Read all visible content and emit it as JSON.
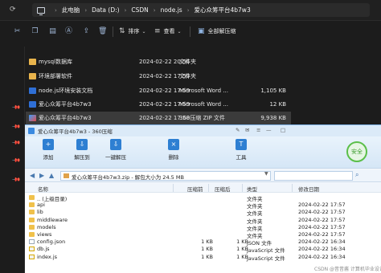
{
  "explorer": {
    "breadcrumb": [
      "此电脑",
      "Data (D:)",
      "CSDN",
      "node.js",
      "爱心众筹平台4b7w3"
    ],
    "toolbar": {
      "sort_label": "排序",
      "view_label": "查看",
      "extract_all_label": "全部解压缩"
    },
    "files": [
      {
        "name": "mysql数据库",
        "date": "2024-02-22 20:56",
        "type": "文件夹",
        "size": "",
        "icon": "folder-icon"
      },
      {
        "name": "环境部署软件",
        "date": "2024-02-22 17:59",
        "type": "文件夹",
        "size": "",
        "icon": "folder-icon"
      },
      {
        "name": "node.js环境安装文档",
        "date": "2024-02-22 17:59",
        "type": "Microsoft Word ...",
        "size": "1,105 KB",
        "icon": "word-doc-icon"
      },
      {
        "name": "爱心众筹平台4b7w3",
        "date": "2024-02-22 17:59",
        "type": "Microsoft Word ...",
        "size": "12 KB",
        "icon": "word-doc-icon"
      },
      {
        "name": "爱心众筹平台4b7w3",
        "date": "2024-02-22 17:58",
        "type": "360压缩 ZIP 文件",
        "size": "9,938 KB",
        "icon": "zip-icon"
      }
    ]
  },
  "zip": {
    "title": "爱心众筹平台4b7w3 - 360压缩",
    "tools": [
      {
        "label": "添加",
        "glyph": "+"
      },
      {
        "label": "解压到",
        "glyph": "⇩"
      },
      {
        "label": "一键解压",
        "glyph": "⇩"
      },
      {
        "label": "删除",
        "glyph": "×"
      },
      {
        "label": "工具",
        "glyph": "T"
      }
    ],
    "safe_label": "安全",
    "path_text": "爱心众筹平台4b7w3.zip - 解包大小为 24.5 MB",
    "columns": {
      "name": "名称",
      "size": "压缩前",
      "compressed": "压缩后",
      "type": "类型",
      "date": "修改日期"
    },
    "rows": [
      {
        "name": ".. (上级目录)",
        "size": "",
        "compressed": "",
        "type": "文件夹",
        "date": "",
        "kind": "folder"
      },
      {
        "name": "api",
        "size": "",
        "compressed": "",
        "type": "文件夹",
        "date": "2024-02-22 17:57",
        "kind": "folder"
      },
      {
        "name": "lib",
        "size": "",
        "compressed": "",
        "type": "文件夹",
        "date": "2024-02-22 17:57",
        "kind": "folder"
      },
      {
        "name": "middleware",
        "size": "",
        "compressed": "",
        "type": "文件夹",
        "date": "2024-02-22 17:57",
        "kind": "folder"
      },
      {
        "name": "models",
        "size": "",
        "compressed": "",
        "type": "文件夹",
        "date": "2024-02-22 17:57",
        "kind": "folder"
      },
      {
        "name": "views",
        "size": "",
        "compressed": "",
        "type": "文件夹",
        "date": "2024-02-22 17:57",
        "kind": "folder"
      },
      {
        "name": "config.json",
        "size": "1 KB",
        "compressed": "1 KB",
        "type": "JSON 文件",
        "date": "2024-02-22 16:34",
        "kind": "file"
      },
      {
        "name": "db.js",
        "size": "1 KB",
        "compressed": "1 KB",
        "type": "JavaScript 文件",
        "date": "2024-02-22 16:34",
        "kind": "js"
      },
      {
        "name": "index.js",
        "size": "1 KB",
        "compressed": "1 KB",
        "type": "JavaScript 文件",
        "date": "2024-02-22 16:34",
        "kind": "js"
      }
    ]
  },
  "watermark": "CSDN @昔昔酱    计算机毕业设计程序"
}
